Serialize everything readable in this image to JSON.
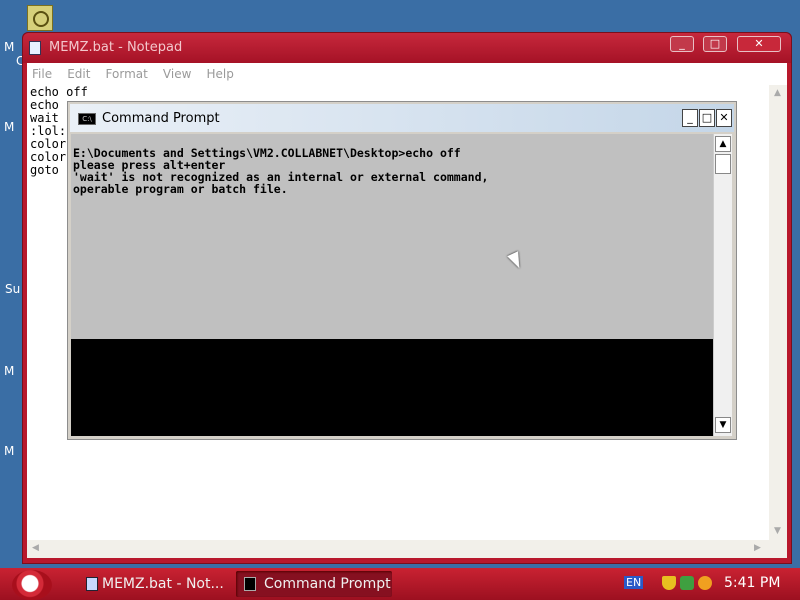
{
  "desktop": {
    "icon_labels": [
      "M",
      "C",
      "M",
      "Su",
      "M",
      "M"
    ]
  },
  "notepad": {
    "title": "MEMZ.bat - Notepad",
    "menu": [
      "File",
      "Edit",
      "Format",
      "View",
      "Help"
    ],
    "lines": [
      "echo off",
      "echo",
      "wait",
      ":lol:",
      "color",
      "color",
      "goto"
    ],
    "buttons": {
      "minimize": "_",
      "maximize": "□",
      "close": "✕"
    }
  },
  "cmd": {
    "title": "Command Prompt",
    "output": [
      "E:\\Documents and Settings\\VM2.COLLABNET\\Desktop>echo off",
      "please press alt+enter",
      "'wait' is not recognized as an internal or external command,",
      "operable program or batch file."
    ],
    "buttons": {
      "minimize": "_",
      "maximize": "□",
      "close": "✕"
    },
    "icon_text": "C:\\"
  },
  "taskbar": {
    "items": [
      {
        "label": "MEMZ.bat - Not...",
        "active": false
      },
      {
        "label": "Command Prompt",
        "active": true
      }
    ],
    "language": "EN",
    "clock": "5:41 PM"
  },
  "colors": {
    "window_frame": "#b8182c",
    "taskbar": "#c92232",
    "desktop": "#3a6ea5"
  }
}
